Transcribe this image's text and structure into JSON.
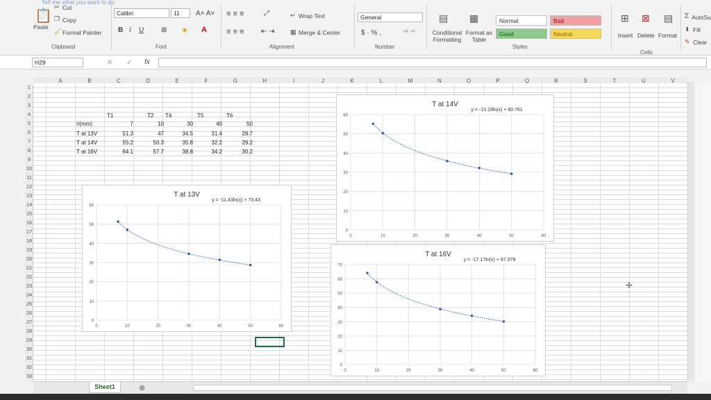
{
  "ribbon": {
    "clipboard": {
      "paste": "Paste",
      "cut": "Cut",
      "copy": "Copy",
      "format_painter": "Format Painter",
      "label": "Clipboard"
    },
    "font": {
      "name": "Calibri",
      "size": "11",
      "label": "Font"
    },
    "alignment": {
      "wrap_text": "Wrap Text",
      "merge_center": "Merge & Center",
      "label": "Alignment"
    },
    "number": {
      "format": "General",
      "label": "Number"
    },
    "styles": {
      "conditional": "Conditional Formatting",
      "format_as_table": "Format as Table",
      "normal": "Normal",
      "bad": "Bad",
      "good": "Good",
      "neutral": "Neutral",
      "label": "Styles"
    },
    "cells": {
      "insert": "Insert",
      "delete": "Delete",
      "format": "Format",
      "label": "Cells"
    },
    "editing": {
      "autosum": "AutoSu",
      "fill": "Fill",
      "clear": "Clear"
    },
    "tell_me": "Tell me what you want to do"
  },
  "formula_bar": {
    "name_box": "H29",
    "fx": "fx",
    "content": ""
  },
  "columns": [
    "A",
    "B",
    "C",
    "D",
    "E",
    "F",
    "G",
    "H",
    "I",
    "J",
    "K",
    "L",
    "M",
    "N",
    "O",
    "P",
    "Q",
    "R",
    "S",
    "T",
    "U",
    "V"
  ],
  "rows": [
    "1",
    "2",
    "3",
    "4",
    "5",
    "6",
    "7",
    "8",
    "9",
    "10",
    "11",
    "12",
    "13",
    "14",
    "15",
    "16",
    "17",
    "18",
    "19",
    "20",
    "21",
    "22",
    "23",
    "24",
    "25",
    "26",
    "27",
    "28",
    "29",
    "30",
    "31",
    "32",
    "33"
  ],
  "table": {
    "headers": [
      "T1",
      "T2",
      "T4",
      "T5",
      "T6"
    ],
    "row_label_header": "ri(mm)",
    "radii": [
      "7",
      "10",
      "30",
      "40",
      "50"
    ],
    "rows": [
      {
        "label": "T at 13V",
        "values": [
          "51.3",
          "47",
          "34.5",
          "31.4",
          "28.7"
        ]
      },
      {
        "label": "T at 14V",
        "values": [
          "55.2",
          "50.3",
          "35.8",
          "32.2",
          "29.2"
        ]
      },
      {
        "label": "T at 16V",
        "values": [
          "64.1",
          "57.7",
          "38.8",
          "34.2",
          "30.2"
        ]
      }
    ]
  },
  "sheet_tab": "Sheet1",
  "chart_data": [
    {
      "type": "scatter",
      "title": "T at 13V",
      "trendline": "y = -11.43ln(x) + 73.43",
      "x": [
        7,
        10,
        30,
        40,
        50
      ],
      "y": [
        51.3,
        47,
        34.5,
        31.4,
        28.7
      ],
      "xlim": [
        0,
        60
      ],
      "ylim": [
        0,
        60
      ],
      "xticks": [
        "0",
        "10",
        "20",
        "30",
        "40",
        "50",
        "60"
      ],
      "yticks": [
        "0",
        "10",
        "20",
        "30",
        "40",
        "50",
        "60"
      ],
      "grid": true,
      "color": "#2e5fa8"
    },
    {
      "type": "scatter",
      "title": "T at 14V",
      "trendline": "y = -13.19ln(x) + 80.761",
      "x": [
        7,
        10,
        30,
        40,
        50
      ],
      "y": [
        55.2,
        50.3,
        35.8,
        32.2,
        29.2
      ],
      "xlim": [
        0,
        60
      ],
      "ylim": [
        0,
        60
      ],
      "xticks": [
        "0",
        "10",
        "20",
        "30",
        "40",
        "50",
        "60"
      ],
      "yticks": [
        "0",
        "10",
        "20",
        "30",
        "40",
        "50",
        "60"
      ],
      "grid": true,
      "color": "#2e5fa8"
    },
    {
      "type": "scatter",
      "title": "T at 16V",
      "trendline": "y = -17.17ln(x) + 97.379",
      "x": [
        7,
        10,
        30,
        40,
        50
      ],
      "y": [
        64.1,
        57.7,
        38.8,
        34.2,
        30.2
      ],
      "xlim": [
        0,
        60
      ],
      "ylim": [
        0,
        70
      ],
      "xticks": [
        "0",
        "10",
        "20",
        "30",
        "40",
        "50",
        "60"
      ],
      "yticks": [
        "0",
        "10",
        "20",
        "30",
        "40",
        "50",
        "60",
        "70"
      ],
      "grid": true,
      "color": "#2e5fa8"
    }
  ]
}
